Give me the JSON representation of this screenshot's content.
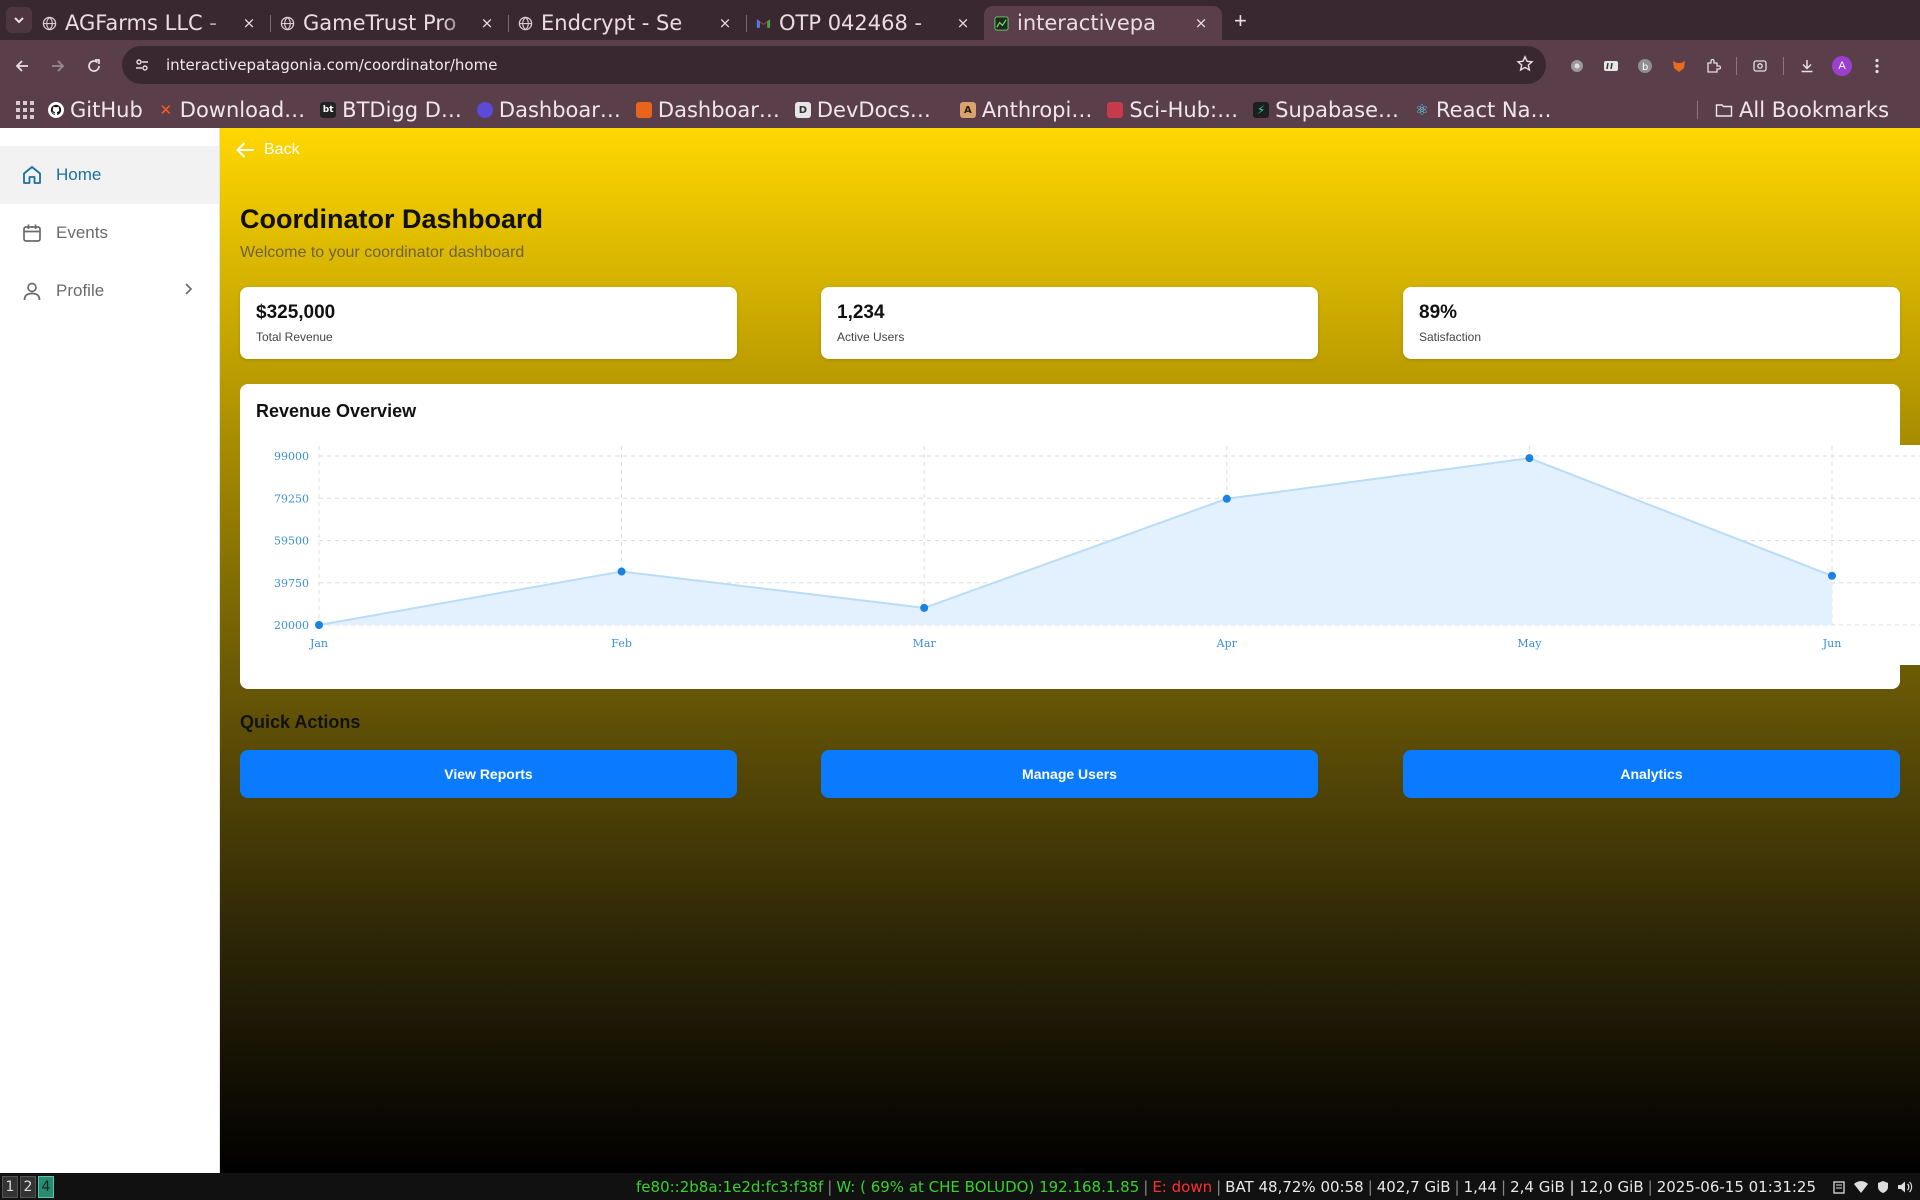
{
  "browser": {
    "tabs": [
      {
        "title": "AGFarms LLC - ",
        "favicon": "globe-icon",
        "active": false
      },
      {
        "title": "GameTrust Pro",
        "favicon": "globe-icon",
        "active": false
      },
      {
        "title": "Endcrypt - Se",
        "favicon": "globe-icon",
        "active": false
      },
      {
        "title": "OTP 042468 - ",
        "favicon": "gmail-icon",
        "active": false
      },
      {
        "title": "interactivepa",
        "favicon": "site-icon",
        "active": true
      }
    ],
    "close_glyph": "×",
    "new_tab_glyph": "+",
    "url": "interactivepatagonia.com/coordinator/home",
    "bookmarks": [
      {
        "label": "GitHub",
        "icon": "github-icon",
        "color": "#ffffff"
      },
      {
        "label": "Download…",
        "icon": "x-icon",
        "color": "#ff5a1f"
      },
      {
        "label": "BTDigg D…",
        "icon": "btdigg-icon",
        "color": "#222222"
      },
      {
        "label": "Dashboar…",
        "icon": "dashboard-icon",
        "color": "#5b4bd8"
      },
      {
        "label": "Dashboar…",
        "icon": "dashboard-icon",
        "color": "#e8641b"
      },
      {
        "label": "DevDocs…",
        "icon": "devdocs-icon",
        "color": "#e6e6e6"
      },
      {
        "label": "Anthropi…",
        "icon": "anthropic-icon",
        "color": "#d9a46c"
      },
      {
        "label": "Sci-Hub:…",
        "icon": "scihub-icon",
        "color": "#c73a4a"
      },
      {
        "label": "Supabase…",
        "icon": "supabase-icon",
        "color": "#1e1e1e"
      },
      {
        "label": "React Na…",
        "icon": "react-icon",
        "color": "#61dafb"
      }
    ],
    "all_bookmarks": "All Bookmarks",
    "avatar_letter": "A"
  },
  "sidebar": {
    "items": [
      {
        "label": "Home",
        "icon": "home-icon",
        "active": true
      },
      {
        "label": "Events",
        "icon": "calendar-icon",
        "active": false
      },
      {
        "label": "Profile",
        "icon": "user-icon",
        "active": false,
        "has_chevron": true
      }
    ]
  },
  "page": {
    "back_label": "Back",
    "title": "Coordinator Dashboard",
    "subtitle": "Welcome to your coordinator dashboard"
  },
  "stats": [
    {
      "value": "$325,000",
      "label": "Total Revenue"
    },
    {
      "value": "1,234",
      "label": "Active Users"
    },
    {
      "value": "89%",
      "label": "Satisfaction"
    }
  ],
  "chart_card_title": "Revenue Overview",
  "chart_data": {
    "type": "area",
    "categories": [
      "Jan",
      "Feb",
      "Mar",
      "Apr",
      "May",
      "Jun"
    ],
    "values": [
      20000,
      45000,
      28000,
      79000,
      98000,
      43000
    ],
    "yticks": [
      "99000",
      "79250",
      "59500",
      "39750",
      "20000"
    ],
    "ylim": [
      20000,
      99000
    ],
    "grid": true,
    "colors": {
      "line": "#b9dcf7",
      "fill": "#e3f0fd",
      "point": "#1a82e2",
      "tick": "#3b8fd9",
      "grid": "#dcdcdc"
    }
  },
  "quick_actions": {
    "title": "Quick Actions",
    "buttons": [
      "View Reports",
      "Manage Users",
      "Analytics"
    ]
  },
  "statusbar": {
    "workspaces": [
      "1",
      "2",
      "4"
    ],
    "active_workspace": "4",
    "ipv6": "fe80::2b8a:1e2d:fc3:f38f",
    "wifi": "W: ( 69% at CHE BOLUDO) 192.168.1.85",
    "ethernet": "E: down",
    "battery": "BAT 48,72% 00:58",
    "disk": "402,7 GiB",
    "load": "1,44",
    "memory": "2,4 GiB | 12,0 GiB",
    "datetime": "2025-06-15 01:31:25"
  },
  "colors": {
    "accent": "#0a7bff",
    "sidebar_active_text": "#1b6f9c",
    "status_green": "#39d12e",
    "status_red": "#ff3030"
  }
}
